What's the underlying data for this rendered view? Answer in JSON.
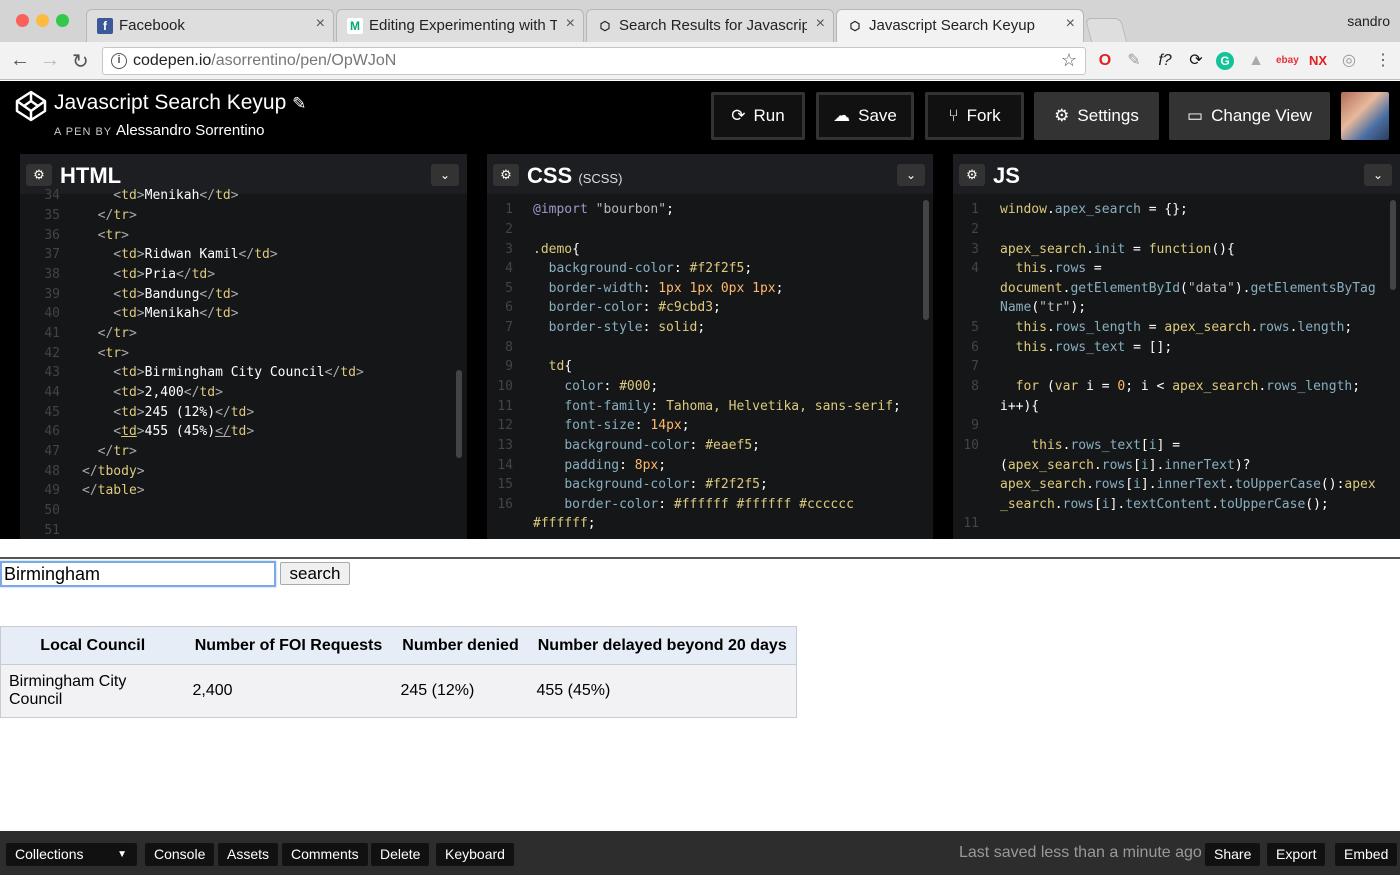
{
  "browser": {
    "tabs": [
      {
        "title": "Facebook",
        "icon": "facebook-icon",
        "color": "#3b5998"
      },
      {
        "title": "Editing Experimenting with Tab",
        "icon": "medium-icon",
        "color": "#00ab6c"
      },
      {
        "title": "Search Results for Javascript s",
        "icon": "codepen-icon",
        "color": "#222222"
      },
      {
        "title": "Javascript Search Keyup",
        "icon": "codepen-icon",
        "color": "#222222"
      }
    ],
    "user": "sandro",
    "url_host": "codepen.io",
    "url_path": "/asorrentino/pen/OpWJoN"
  },
  "pen": {
    "title": "Javascript Search Keyup",
    "by_prefix": "A PEN BY",
    "author": "Alessandro Sorrentino",
    "buttons": {
      "run": "Run",
      "save": "Save",
      "fork": "Fork",
      "settings": "Settings",
      "change_view": "Change View"
    }
  },
  "editors": {
    "html": {
      "name": "HTML"
    },
    "css": {
      "name": "CSS",
      "sub": "(SCSS)"
    },
    "js": {
      "name": "JS"
    }
  },
  "result": {
    "search_value": "Birmingham",
    "search_button": "search",
    "table": {
      "headers": [
        "Local Council",
        "Number of FOI Requests",
        "Number denied",
        "Number delayed beyond 20 days"
      ],
      "rows": [
        [
          "Birmingham City Council",
          "2,400",
          "245 (12%)",
          "455 (45%)"
        ]
      ]
    }
  },
  "footer": {
    "collections": "Collections",
    "console": "Console",
    "assets": "Assets",
    "comments": "Comments",
    "delete": "Delete",
    "keyboard": "Keyboard",
    "saved": "Last saved less than a minute ago",
    "share": "Share",
    "export": "Export",
    "embed": "Embed"
  }
}
